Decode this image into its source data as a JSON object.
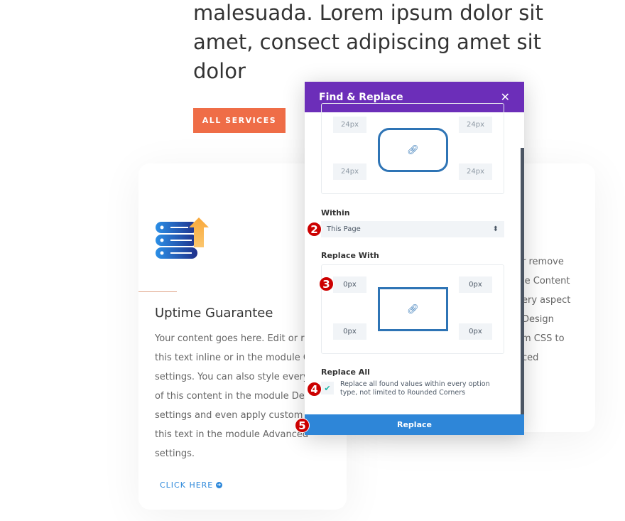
{
  "hero": {
    "lines": [
      "malesuada. Lorem ipsum dolor sit",
      "amet, consect adipiscing amet sit",
      "dolor"
    ],
    "button": "ALL SERVICES"
  },
  "card1": {
    "icon": "server-upload-icon",
    "title": "Uptime Guarantee",
    "text": [
      "Your content goes here. Edit or remove",
      "this text inline or in the module Content",
      "settings. You can also style every aspect",
      "of this content in the module Design",
      "settings and even apply custom CSS to",
      "this text in the module Advanced",
      "settings."
    ],
    "link": "CLICK HERE"
  },
  "card2": {
    "text": [
      "r remove",
      "le Content",
      "ery aspect",
      "Design",
      "m CSS to",
      "ced"
    ]
  },
  "modal": {
    "title": "Find & Replace",
    "find_values": {
      "tl": "24px",
      "tr": "24px",
      "bl": "24px",
      "br": "24px"
    },
    "within_label": "Within",
    "within_value": "This Page",
    "replace_with_label": "Replace With",
    "replace_values": {
      "tl": "0px",
      "tr": "0px",
      "bl": "0px",
      "br": "0px"
    },
    "replace_all_label": "Replace All",
    "replace_all_text": "Replace all found values within every option type, not limited to Rounded Corners",
    "replace_all_checked": true,
    "replace_button": "Replace"
  },
  "badges": [
    "2",
    "3",
    "4",
    "5"
  ],
  "colors": {
    "header": "#6c2eb9",
    "accent": "#2e86d8",
    "cta": "#ef6d47",
    "badge": "#cc0000"
  }
}
